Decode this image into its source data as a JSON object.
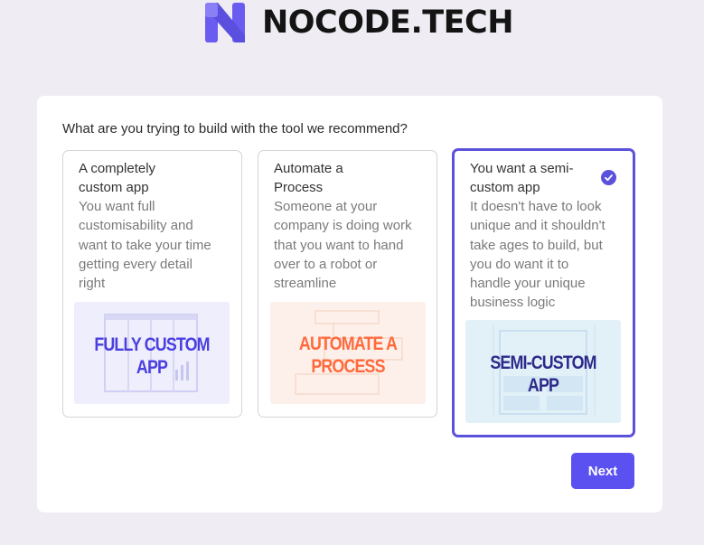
{
  "brand": {
    "name": "NOCODE.TECH"
  },
  "question": "What are you trying to build with the tool we recommend?",
  "options": [
    {
      "title_lines": [
        "A completely",
        "custom app"
      ],
      "desc_lines": [
        "You want full",
        "customisability and",
        "want to take your time",
        "getting every detail",
        "right"
      ],
      "image_lines": [
        "FULLY CUSTOM",
        "APP"
      ],
      "selected": false
    },
    {
      "title_lines": [
        "Automate a",
        "Process"
      ],
      "desc_lines": [
        "Someone at your",
        "company is doing work",
        "that you want to hand",
        "over to a robot or",
        "streamline"
      ],
      "image_lines": [
        "AUTOMATE A",
        "PROCESS"
      ],
      "selected": false
    },
    {
      "title_lines": [
        "You want a semi-",
        "custom app"
      ],
      "desc_lines": [
        "It doesn't have to look",
        "unique and it shouldn't",
        "take ages to build, but",
        "you do want it to",
        "handle your unique",
        "business logic"
      ],
      "image_lines": [
        "SEMI-CUSTOM",
        "APP"
      ],
      "selected": true
    }
  ],
  "actions": {
    "next_label": "Next"
  },
  "colors": {
    "accent": "#5b51db",
    "button": "#5b51f0",
    "custom_image_bg": "#eeeefc",
    "custom_image_text": "#4b3fe0",
    "automate_image_bg": "#fdf0ea",
    "automate_image_text": "#ff6a3d",
    "semi_image_bg": "#e2f0f8",
    "semi_image_text": "#2e2a8a"
  }
}
